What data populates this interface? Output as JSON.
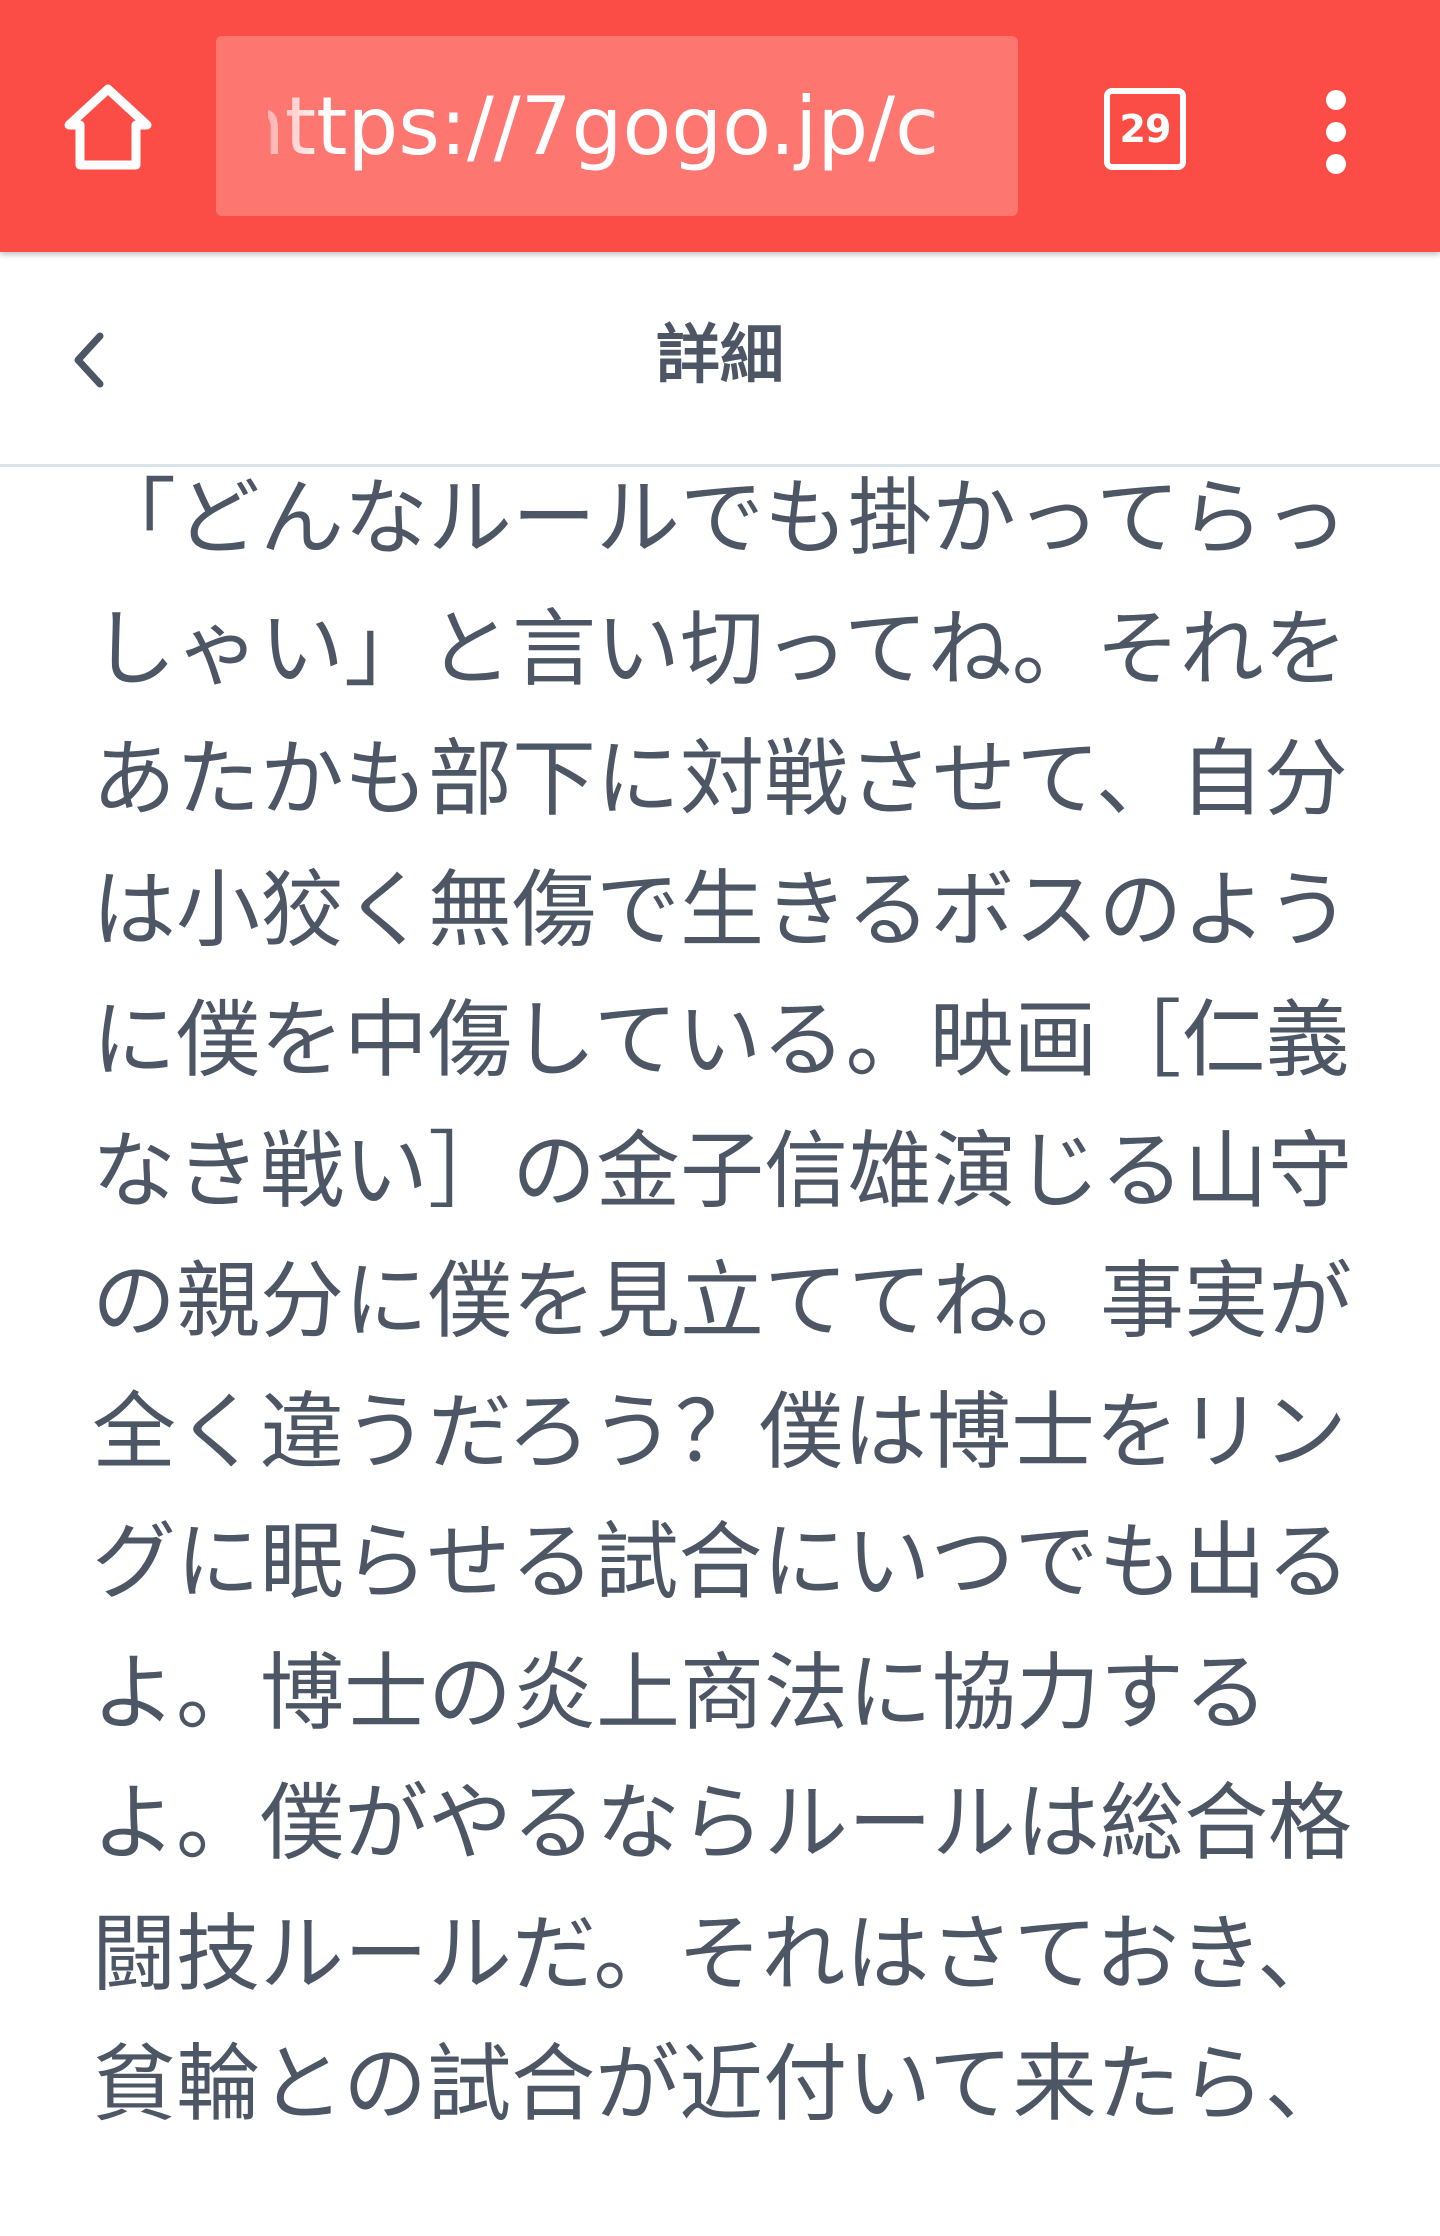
{
  "browser": {
    "url": "https://7gogo.jp/c",
    "tab_count": "29",
    "toolbar_color": "#fb4d45"
  },
  "header": {
    "title": "詳細"
  },
  "post": {
    "text": "「どんなルールでも掛かってらっしゃい」と言い切ってね。それをあたかも部下に対戦させて、自分は小狡く無傷で生きるボスのように僕を中傷している。映画［仁義なき戦い］の金子信雄演じる山守の親分に僕を見立ててね。事実が全く違うだろう？僕は博士をリングに眠らせる試合にいつでも出るよ。博士の炎上商法に協力するよ。僕がやるならルールは総合格闘技ルールだ。それはさておき、貧輪との試合が近付いて来たら、"
  },
  "icons": {
    "home": "home-icon",
    "tabs": "tab-switcher-icon",
    "menu": "more-vertical-icon",
    "back": "chevron-left-icon"
  }
}
